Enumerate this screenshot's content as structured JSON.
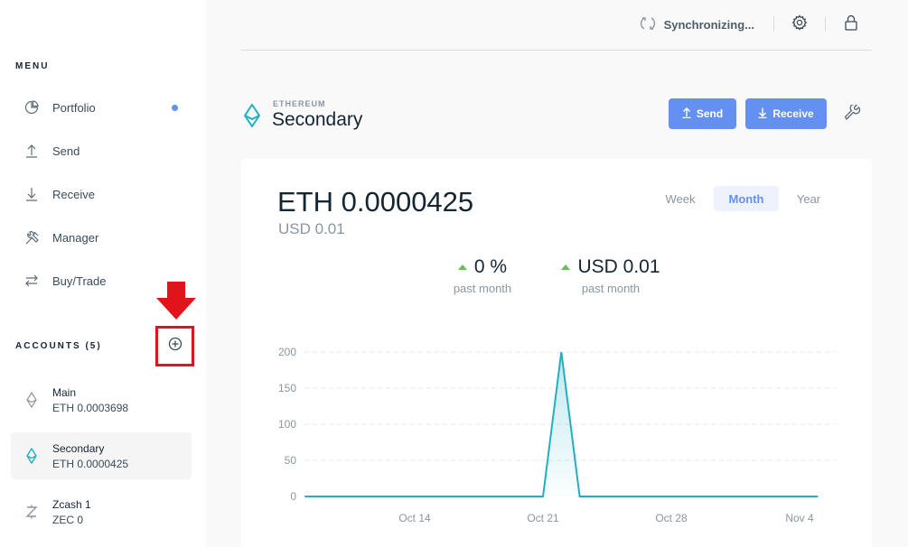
{
  "sidebar": {
    "menu_label": "MENU",
    "items": [
      {
        "label": "Portfolio",
        "icon": "pie-chart-icon"
      },
      {
        "label": "Send",
        "icon": "arrow-up-icon"
      },
      {
        "label": "Receive",
        "icon": "arrow-down-icon"
      },
      {
        "label": "Manager",
        "icon": "tools-icon"
      },
      {
        "label": "Buy/Trade",
        "icon": "swap-icon"
      }
    ],
    "accounts_label": "ACCOUNTS (5)",
    "accounts": [
      {
        "name": "Main",
        "balance": "ETH 0.0003698",
        "icon": "ethereum-icon"
      },
      {
        "name": "Secondary",
        "balance": "ETH 0.0000425",
        "icon": "ethereum-icon"
      },
      {
        "name": "Zcash 1",
        "balance": "ZEC 0",
        "icon": "zcash-icon"
      }
    ]
  },
  "topbar": {
    "sync_label": "Synchronizing..."
  },
  "account_header": {
    "currency": "ETHEREUM",
    "name": "Secondary",
    "send_label": "Send",
    "receive_label": "Receive"
  },
  "balance": {
    "main": "ETH 0.0000425",
    "fiat": "USD 0.01"
  },
  "ranges": {
    "week": "Week",
    "month": "Month",
    "year": "Year",
    "selected": "Month"
  },
  "deltas": {
    "percent": "0 %",
    "percent_caption": "past month",
    "fiat": "USD 0.01",
    "fiat_caption": "past month"
  },
  "colors": {
    "accent": "#6490f1",
    "eth_teal": "#1fb1c2",
    "positive": "#66be54",
    "highlight": "#e1141b"
  },
  "chart_data": {
    "type": "area",
    "y_ticks": [
      "0",
      "50",
      "100",
      "150",
      "200"
    ],
    "x_ticks": [
      "Oct 14",
      "Oct 21",
      "Oct 28",
      "Nov 4"
    ],
    "ylim": [
      0,
      200
    ],
    "points": [
      {
        "x": "Oct 8",
        "y": 0
      },
      {
        "x": "Oct 21",
        "y": 0
      },
      {
        "x": "Oct 22",
        "y": 200
      },
      {
        "x": "Oct 23",
        "y": 0
      },
      {
        "x": "Nov 5",
        "y": 0
      }
    ]
  }
}
